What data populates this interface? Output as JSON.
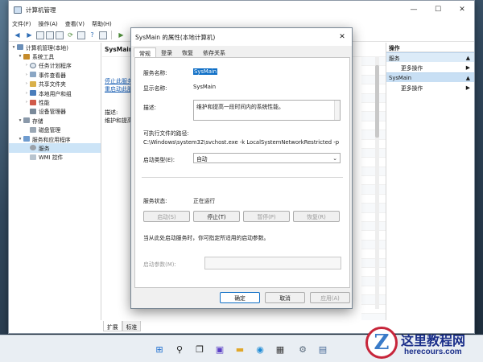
{
  "window": {
    "title": "计算机管理",
    "controls": [
      "—",
      "☐",
      "✕"
    ]
  },
  "menu": [
    "文件(F)",
    "操作(A)",
    "查看(V)",
    "帮助(H)"
  ],
  "tree": [
    {
      "label": "计算机管理(本地)",
      "level": 0,
      "arrow": "▾",
      "icon": "computer-icon"
    },
    {
      "label": "系统工具",
      "level": 1,
      "arrow": "▾",
      "icon": "tools-icon"
    },
    {
      "label": "任务计划程序",
      "level": 2,
      "arrow": "›",
      "icon": "clock-icon"
    },
    {
      "label": "事件查看器",
      "level": 2,
      "arrow": "›",
      "icon": "event-viewer-icon"
    },
    {
      "label": "共享文件夹",
      "level": 2,
      "arrow": "›",
      "icon": "shared-folder-icon"
    },
    {
      "label": "本地用户和组",
      "level": 2,
      "arrow": "›",
      "icon": "users-icon"
    },
    {
      "label": "性能",
      "level": 2,
      "arrow": "›",
      "icon": "performance-icon"
    },
    {
      "label": "设备管理器",
      "level": 2,
      "arrow": "",
      "icon": "device-manager-icon"
    },
    {
      "label": "存储",
      "level": 1,
      "arrow": "▾",
      "icon": "storage-icon"
    },
    {
      "label": "磁盘管理",
      "level": 2,
      "arrow": "",
      "icon": "disk-icon"
    },
    {
      "label": "服务和应用程序",
      "level": 1,
      "arrow": "▾",
      "icon": "services-apps-icon"
    },
    {
      "label": "服务",
      "level": 2,
      "arrow": "",
      "icon": "gear-icon",
      "selected": true
    },
    {
      "label": "WMI 控件",
      "level": 2,
      "arrow": "",
      "icon": "wmi-icon"
    }
  ],
  "center": {
    "header": "SysMain",
    "link1": "停止此服务",
    "link2": "重启动此服务",
    "desc_label": "描述:",
    "desc_text": "维护和提高"
  },
  "bottom_tabs": [
    "扩展",
    "标准"
  ],
  "actions": {
    "title": "操作",
    "sections": [
      {
        "label": "服务",
        "item": "更多操作"
      },
      {
        "label": "SysMain",
        "item": "更多操作"
      }
    ]
  },
  "dialog": {
    "title": "SysMain 的属性(本地计算机)",
    "tabs": [
      "常规",
      "登录",
      "恢复",
      "依存关系"
    ],
    "service_name_label": "服务名称:",
    "service_name": "SysMain",
    "display_name_label": "显示名称:",
    "display_name": "SysMain",
    "description_label": "描述:",
    "description": "维护和提高一段时间内的系统性能。",
    "exe_path_label": "可执行文件的路径:",
    "exe_path": "C:\\Windows\\system32\\svchost.exe -k LocalSystemNetworkRestricted -p",
    "startup_type_label": "启动类型(E):",
    "startup_type": "自动",
    "status_label": "服务状态:",
    "status": "正在运行",
    "buttons": {
      "start": "启动(S)",
      "stop": "停止(T)",
      "pause": "暂停(P)",
      "resume": "恢复(R)"
    },
    "hint": "当从此处启动服务时，你可指定所适用的启动参数。",
    "param_label": "启动参数(M):",
    "ok": "确定",
    "cancel": "取消",
    "apply": "应用(A)"
  },
  "brand": {
    "logo_letter": "Z",
    "name": "这里教程网",
    "url": "herecours.com"
  }
}
